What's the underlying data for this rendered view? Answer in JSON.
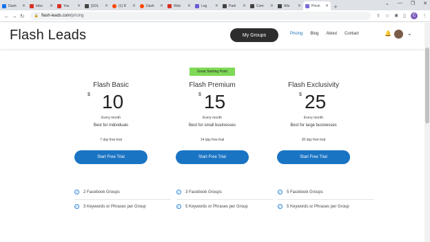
{
  "browser": {
    "tabs": [
      {
        "label": "Dash",
        "color": "#1a73e8"
      },
      {
        "label": "Inbo",
        "color": "#d93025"
      },
      {
        "label": "You",
        "color": "#d93025"
      },
      {
        "label": "[SOL",
        "color": "#444444"
      },
      {
        "label": "(1) R",
        "color": "#ff4500"
      },
      {
        "label": "Dash",
        "color": "#ff4500"
      },
      {
        "label": "Web",
        "color": "#d93025"
      },
      {
        "label": "Log",
        "color": "#6b5bd6"
      },
      {
        "label": "Parti",
        "color": "#444444"
      },
      {
        "label": "Com",
        "color": "#444444"
      },
      {
        "label": "Wix",
        "color": "#444444"
      },
      {
        "label": "Pricin",
        "color": "#7b6bd8",
        "active": true
      }
    ],
    "new_tab": "+",
    "url_domain": "flash-leads.com",
    "url_path": "/pricing",
    "profile_initial": "C"
  },
  "site": {
    "logo": "Flash Leads",
    "my_groups": "My Groups",
    "nav": [
      {
        "label": "Pricing",
        "active": true
      },
      {
        "label": "Blog"
      },
      {
        "label": "About"
      },
      {
        "label": "Contact"
      }
    ]
  },
  "badge": "Great Starting Point",
  "plans": [
    {
      "name": "Flash Basic",
      "currency": "$",
      "price": "10",
      "period": "Every month",
      "best_for": "Best for individuals",
      "trial": "7 day free trial",
      "cta": "Start Free Trial",
      "features": [
        "2 Facebook Groups",
        "3 Keywords or Phrases per Group"
      ]
    },
    {
      "name": "Flash Premium",
      "currency": "$",
      "price": "15",
      "period": "Every month",
      "best_for": "Best for small businesses",
      "trial": "14 day free trial",
      "cta": "Start Free Trial",
      "features": [
        "3 Facebook Groups",
        "5 Keywords or Phrases per Group"
      ]
    },
    {
      "name": "Flash Exclusivity",
      "currency": "$",
      "price": "25",
      "period": "Every month",
      "best_for": "Best for large businesses",
      "trial": "30 day free trial",
      "cta": "Start Free Trial",
      "features": [
        "5 Facebook Groups",
        "5 Keywords or Phrases per Group"
      ]
    }
  ],
  "colors": {
    "cta_blue": "#1a74c4",
    "badge_green": "#7ed957",
    "nav_active": "#1a6fb5"
  }
}
